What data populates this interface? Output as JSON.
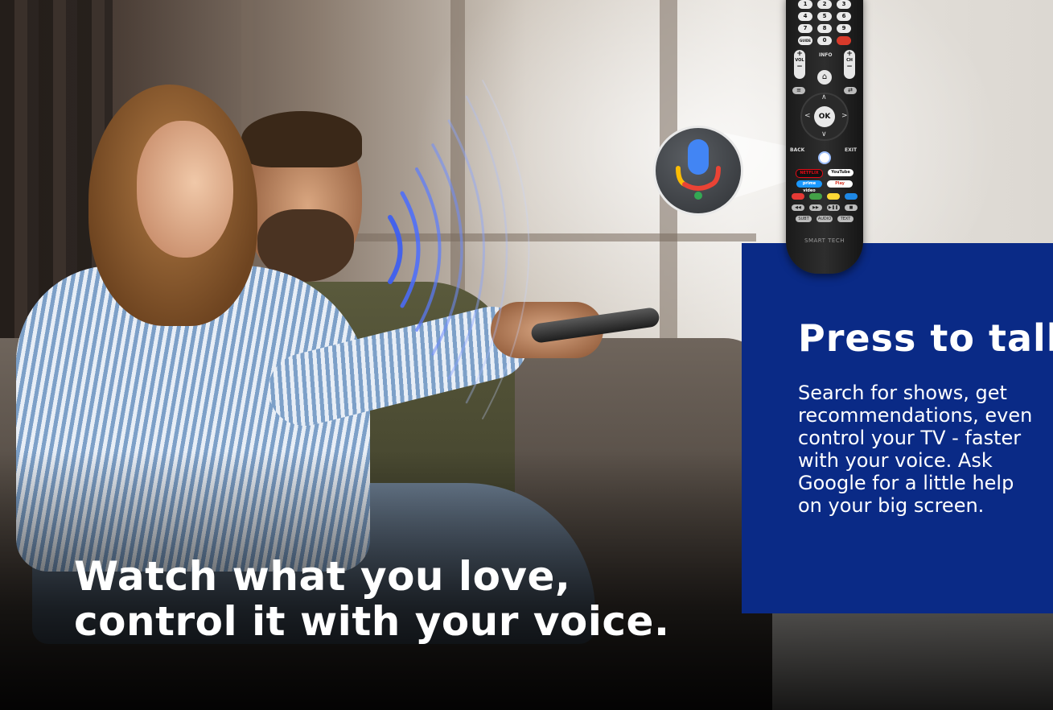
{
  "hero": {
    "headline_line1": "Watch what you love,",
    "headline_line2": "control it with your voice."
  },
  "panel": {
    "title": "Press to talk",
    "body_lines": [
      "Search for shows, get",
      "recommendations, even",
      "control your TV - faster",
      "with your voice. Ask",
      "Google for a little help",
      "on your big screen."
    ]
  },
  "remote": {
    "number_rows": [
      [
        "1",
        "2",
        "3"
      ],
      [
        "4",
        "5",
        "6"
      ],
      [
        "7",
        "8",
        "9"
      ],
      [
        "GUIDE",
        "0",
        ""
      ]
    ],
    "vol_label": "VOL",
    "ch_label": "CH",
    "info_label": "INFO",
    "ok_label": "OK",
    "back_label": "BACK",
    "exit_label": "EXIT",
    "app_buttons": [
      "NETFLIX",
      "YouTube",
      "prime video",
      "Play"
    ],
    "media_buttons": [
      "◀◀",
      "▶▶",
      "▶❚❚",
      "■"
    ],
    "bottom_buttons": [
      "SUBT",
      "AUDIO",
      "TEXT"
    ],
    "brand": "SMART TECH"
  },
  "colors": {
    "panel_blue": "#0a2a86",
    "headline_white": "#ffffff",
    "wave_blue": "#4a6cff",
    "mic_blue": "#4285f4",
    "mic_red": "#ea4335",
    "mic_yellow": "#fbbc05",
    "mic_green": "#34a853"
  },
  "icons": {
    "mic": "google-mic-icon",
    "waves": "sound-waves-icon",
    "home": "home-icon",
    "menu": "menu-icon",
    "input": "input-icon"
  }
}
